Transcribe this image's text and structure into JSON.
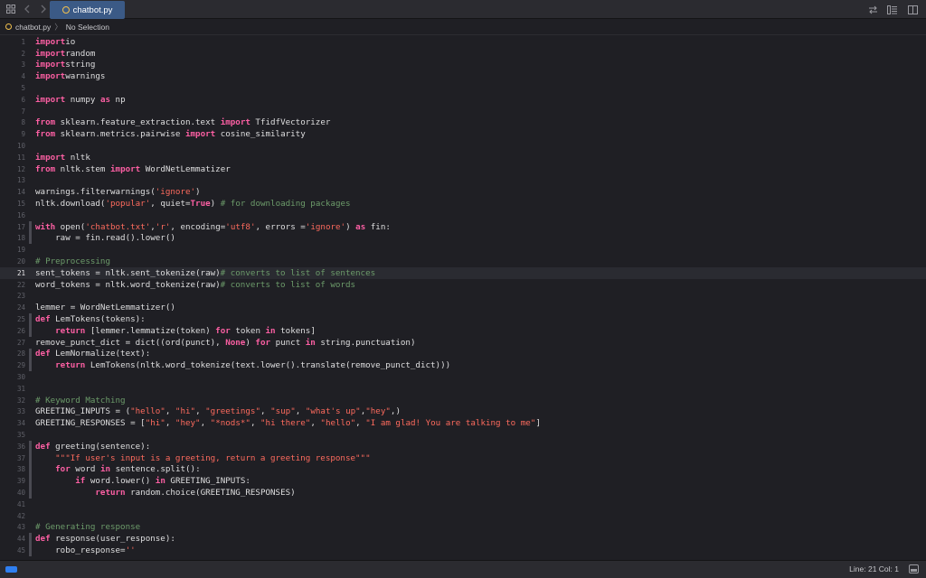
{
  "tab": {
    "label": "chatbot.py"
  },
  "jumpbar": {
    "file": "chatbot.py",
    "selection": "No Selection"
  },
  "status": {
    "position": "Line: 21  Col: 1"
  },
  "current_line": 21,
  "lines": [
    {
      "n": "1",
      "mark": false,
      "tokens": [
        [
          "kw",
          "import"
        ],
        [
          "",
          "io"
        ]
      ]
    },
    {
      "n": "2",
      "mark": false,
      "tokens": [
        [
          "kw",
          "import"
        ],
        [
          "",
          "random"
        ]
      ]
    },
    {
      "n": "3",
      "mark": false,
      "tokens": [
        [
          "kw",
          "import"
        ],
        [
          "",
          "string"
        ]
      ]
    },
    {
      "n": "4",
      "mark": false,
      "tokens": [
        [
          "kw",
          "import"
        ],
        [
          "",
          "warnings"
        ]
      ]
    },
    {
      "n": "5",
      "mark": false,
      "tokens": []
    },
    {
      "n": "6",
      "mark": false,
      "tokens": [
        [
          "kw",
          "import"
        ],
        [
          "",
          " numpy "
        ],
        [
          "kw",
          "as"
        ],
        [
          "",
          " np"
        ]
      ]
    },
    {
      "n": "7",
      "mark": false,
      "tokens": []
    },
    {
      "n": "8",
      "mark": false,
      "tokens": [
        [
          "kw",
          "from"
        ],
        [
          "",
          " sklearn.feature_extraction.text "
        ],
        [
          "kw",
          "import"
        ],
        [
          "",
          " TfidfVectorizer"
        ]
      ]
    },
    {
      "n": "9",
      "mark": false,
      "tokens": [
        [
          "kw",
          "from"
        ],
        [
          "",
          " sklearn.metrics.pairwise "
        ],
        [
          "kw",
          "import"
        ],
        [
          "",
          " cosine_similarity"
        ]
      ]
    },
    {
      "n": "10",
      "mark": false,
      "tokens": []
    },
    {
      "n": "11",
      "mark": false,
      "tokens": [
        [
          "kw",
          "import"
        ],
        [
          "",
          " nltk"
        ]
      ]
    },
    {
      "n": "12",
      "mark": false,
      "tokens": [
        [
          "kw",
          "from"
        ],
        [
          "",
          " nltk.stem "
        ],
        [
          "kw",
          "import"
        ],
        [
          "",
          " WordNetLemmatizer"
        ]
      ]
    },
    {
      "n": "13",
      "mark": false,
      "tokens": []
    },
    {
      "n": "14",
      "mark": false,
      "tokens": [
        [
          "",
          "warnings.filterwarnings("
        ],
        [
          "str",
          "'ignore'"
        ],
        [
          "",
          ")"
        ]
      ]
    },
    {
      "n": "15",
      "mark": false,
      "tokens": [
        [
          "",
          "nltk.download("
        ],
        [
          "str",
          "'popular'"
        ],
        [
          "",
          ", quiet="
        ],
        [
          "bool",
          "True"
        ],
        [
          "",
          ") "
        ],
        [
          "com",
          "# for downloading packages"
        ]
      ]
    },
    {
      "n": "16",
      "mark": false,
      "tokens": []
    },
    {
      "n": "17",
      "mark": true,
      "tokens": [
        [
          "kw",
          "with"
        ],
        [
          "",
          " open("
        ],
        [
          "str",
          "'chatbot.txt'"
        ],
        [
          "",
          ","
        ],
        [
          "str",
          "'r'"
        ],
        [
          "",
          ", encoding="
        ],
        [
          "str",
          "'utf8'"
        ],
        [
          "",
          ", errors ="
        ],
        [
          "str",
          "'ignore'"
        ],
        [
          "",
          ") "
        ],
        [
          "kw",
          "as"
        ],
        [
          "",
          " fin:"
        ]
      ]
    },
    {
      "n": "18",
      "mark": true,
      "tokens": [
        [
          "",
          "    raw = fin.read().lower()"
        ]
      ]
    },
    {
      "n": "19",
      "mark": false,
      "tokens": []
    },
    {
      "n": "20",
      "mark": false,
      "tokens": [
        [
          "com",
          "# Preprocessing"
        ]
      ]
    },
    {
      "n": "21",
      "mark": false,
      "tokens": [
        [
          "",
          "sent_tokens = nltk.sent_tokenize(raw)"
        ],
        [
          "com",
          "# converts to list of sentences"
        ]
      ]
    },
    {
      "n": "22",
      "mark": false,
      "tokens": [
        [
          "",
          "word_tokens = nltk.word_tokenize(raw)"
        ],
        [
          "com",
          "# converts to list of words"
        ]
      ]
    },
    {
      "n": "23",
      "mark": false,
      "tokens": []
    },
    {
      "n": "24",
      "mark": false,
      "tokens": [
        [
          "",
          "lemmer = WordNetLemmatizer()"
        ]
      ]
    },
    {
      "n": "25",
      "mark": true,
      "tokens": [
        [
          "kw",
          "def"
        ],
        [
          "",
          " LemTokens(tokens):"
        ]
      ]
    },
    {
      "n": "26",
      "mark": true,
      "tokens": [
        [
          "",
          "    "
        ],
        [
          "kw",
          "return"
        ],
        [
          "",
          " [lemmer.lemmatize(token) "
        ],
        [
          "kw",
          "for"
        ],
        [
          "",
          " token "
        ],
        [
          "kw",
          "in"
        ],
        [
          "",
          " tokens]"
        ]
      ]
    },
    {
      "n": "27",
      "mark": false,
      "tokens": [
        [
          "",
          "remove_punct_dict = dict((ord(punct), "
        ],
        [
          "bool",
          "None"
        ],
        [
          "",
          ") "
        ],
        [
          "kw",
          "for"
        ],
        [
          "",
          " punct "
        ],
        [
          "kw",
          "in"
        ],
        [
          "",
          " string.punctuation)"
        ]
      ]
    },
    {
      "n": "28",
      "mark": true,
      "tokens": [
        [
          "kw",
          "def"
        ],
        [
          "",
          " LemNormalize(text):"
        ]
      ]
    },
    {
      "n": "29",
      "mark": true,
      "tokens": [
        [
          "",
          "    "
        ],
        [
          "kw",
          "return"
        ],
        [
          "",
          " LemTokens(nltk.word_tokenize(text.lower().translate(remove_punct_dict)))"
        ]
      ]
    },
    {
      "n": "30",
      "mark": false,
      "tokens": []
    },
    {
      "n": "31",
      "mark": false,
      "tokens": []
    },
    {
      "n": "32",
      "mark": false,
      "tokens": [
        [
          "com",
          "# Keyword Matching"
        ]
      ]
    },
    {
      "n": "33",
      "mark": false,
      "tokens": [
        [
          "",
          "GREETING_INPUTS = ("
        ],
        [
          "str",
          "\"hello\""
        ],
        [
          "",
          ", "
        ],
        [
          "str",
          "\"hi\""
        ],
        [
          "",
          ", "
        ],
        [
          "str",
          "\"greetings\""
        ],
        [
          "",
          ", "
        ],
        [
          "str",
          "\"sup\""
        ],
        [
          "",
          ", "
        ],
        [
          "str",
          "\"what's up\""
        ],
        [
          "",
          ","
        ],
        [
          "str",
          "\"hey\""
        ],
        [
          "",
          ",)"
        ]
      ]
    },
    {
      "n": "34",
      "mark": false,
      "tokens": [
        [
          "",
          "GREETING_RESPONSES = ["
        ],
        [
          "str",
          "\"hi\""
        ],
        [
          "",
          ", "
        ],
        [
          "str",
          "\"hey\""
        ],
        [
          "",
          ", "
        ],
        [
          "str",
          "\"*nods*\""
        ],
        [
          "",
          ", "
        ],
        [
          "str",
          "\"hi there\""
        ],
        [
          "",
          ", "
        ],
        [
          "str",
          "\"hello\""
        ],
        [
          "",
          ", "
        ],
        [
          "str",
          "\"I am glad! You are talking to me\""
        ],
        [
          "",
          "]"
        ]
      ]
    },
    {
      "n": "35",
      "mark": false,
      "tokens": []
    },
    {
      "n": "36",
      "mark": true,
      "tokens": [
        [
          "kw",
          "def"
        ],
        [
          "",
          " greeting(sentence):"
        ]
      ]
    },
    {
      "n": "37",
      "mark": true,
      "tokens": [
        [
          "",
          "    "
        ],
        [
          "str",
          "\"\"\"If user's input is a greeting, return a greeting response\"\"\""
        ]
      ]
    },
    {
      "n": "38",
      "mark": true,
      "tokens": [
        [
          "",
          "    "
        ],
        [
          "kw",
          "for"
        ],
        [
          "",
          " word "
        ],
        [
          "kw",
          "in"
        ],
        [
          "",
          " sentence.split():"
        ]
      ]
    },
    {
      "n": "39",
      "mark": true,
      "tokens": [
        [
          "",
          "        "
        ],
        [
          "kw",
          "if"
        ],
        [
          "",
          " word.lower() "
        ],
        [
          "kw",
          "in"
        ],
        [
          "",
          " GREETING_INPUTS:"
        ]
      ]
    },
    {
      "n": "40",
      "mark": true,
      "tokens": [
        [
          "",
          "            "
        ],
        [
          "kw",
          "return"
        ],
        [
          "",
          " random.choice(GREETING_RESPONSES)"
        ]
      ]
    },
    {
      "n": "41",
      "mark": false,
      "tokens": []
    },
    {
      "n": "42",
      "mark": false,
      "tokens": []
    },
    {
      "n": "43",
      "mark": false,
      "tokens": [
        [
          "com",
          "# Generating response"
        ]
      ]
    },
    {
      "n": "44",
      "mark": true,
      "tokens": [
        [
          "kw",
          "def"
        ],
        [
          "",
          " response(user_response):"
        ]
      ]
    },
    {
      "n": "45",
      "mark": true,
      "tokens": [
        [
          "",
          "    robo_response="
        ],
        [
          "str",
          "''"
        ]
      ]
    }
  ]
}
